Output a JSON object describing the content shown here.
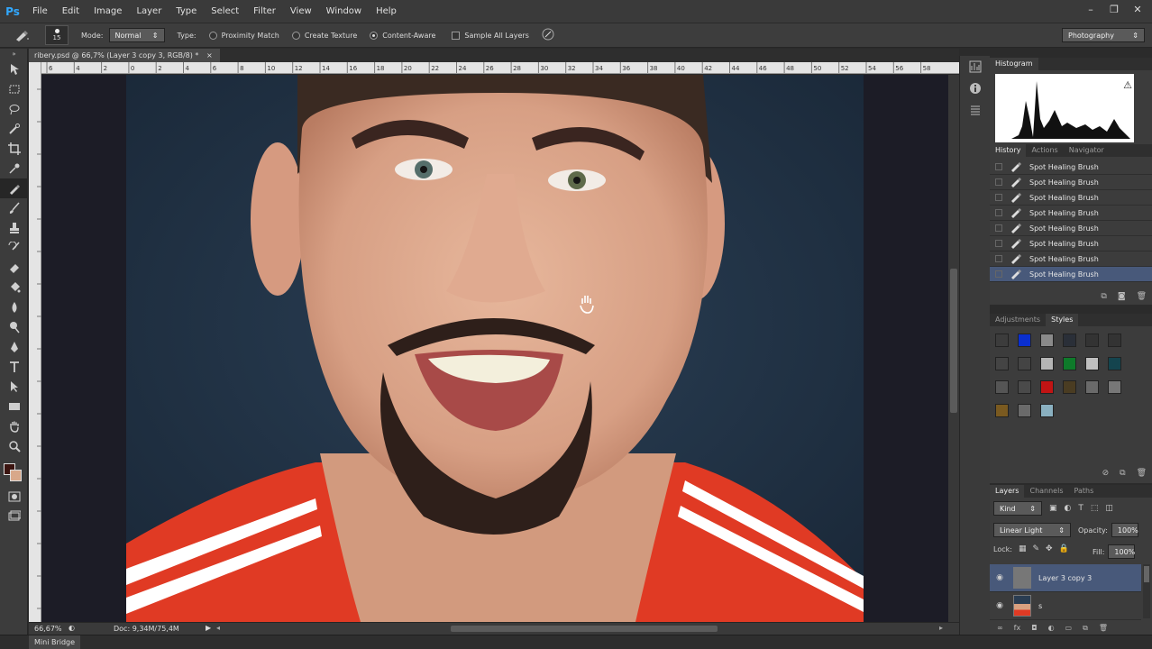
{
  "app": {
    "logo": "Ps"
  },
  "menu": [
    "File",
    "Edit",
    "Image",
    "Layer",
    "Type",
    "Select",
    "Filter",
    "View",
    "Window",
    "Help"
  ],
  "window_controls": [
    "–",
    "❐",
    "✕"
  ],
  "options": {
    "brush_size": "15",
    "mode_label": "Mode:",
    "mode_value": "Normal",
    "type_label": "Type:",
    "type_options": [
      "Proximity Match",
      "Create Texture",
      "Content-Aware"
    ],
    "type_selected": "Content-Aware",
    "sample_all_layers": "Sample All Layers",
    "workspace": "Photography"
  },
  "document": {
    "tab_title": "ribery.psd @ 66,7% (Layer 3 copy 3, RGB/8) *",
    "tab_close": "×",
    "zoom": "66,67%",
    "doc_size": "Doc: 9,34M/75,4M",
    "ruler_marks": [
      "6",
      "4",
      "2",
      "0",
      "2",
      "4",
      "6",
      "8",
      "10",
      "12",
      "14",
      "16",
      "18",
      "20",
      "22",
      "24",
      "26",
      "28",
      "30",
      "32",
      "34",
      "36",
      "38",
      "40",
      "42",
      "44",
      "46",
      "48",
      "50",
      "52",
      "54",
      "56",
      "58"
    ]
  },
  "mini_bridge": "Mini Bridge",
  "colors": {
    "foreground": "#3b1410",
    "background": "#d8a88a",
    "selection": "#48597a"
  },
  "histogram": {
    "tab": "Histogram",
    "warning": "⚠"
  },
  "history_panel": {
    "tabs": [
      "History",
      "Actions",
      "Navigator"
    ],
    "items": [
      "Spot Healing Brush",
      "Spot Healing Brush",
      "Spot Healing Brush",
      "Spot Healing Brush",
      "Spot Healing Brush",
      "Spot Healing Brush",
      "Spot Healing Brush",
      "Spot Healing Brush"
    ],
    "selected_index": 7
  },
  "styles_panel": {
    "tabs": [
      "Adjustments",
      "Styles"
    ]
  },
  "layers_panel": {
    "tabs": [
      "Layers",
      "Channels",
      "Paths"
    ],
    "kind": "Kind",
    "blend_mode": "Linear Light",
    "opacity_label": "Opacity:",
    "opacity": "100%",
    "lock_label": "Lock:",
    "fill_label": "Fill:",
    "fill": "100%",
    "layers": [
      {
        "name": "Layer 3 copy 3",
        "selected": true
      },
      {
        "name": "s",
        "selected": false
      }
    ]
  }
}
